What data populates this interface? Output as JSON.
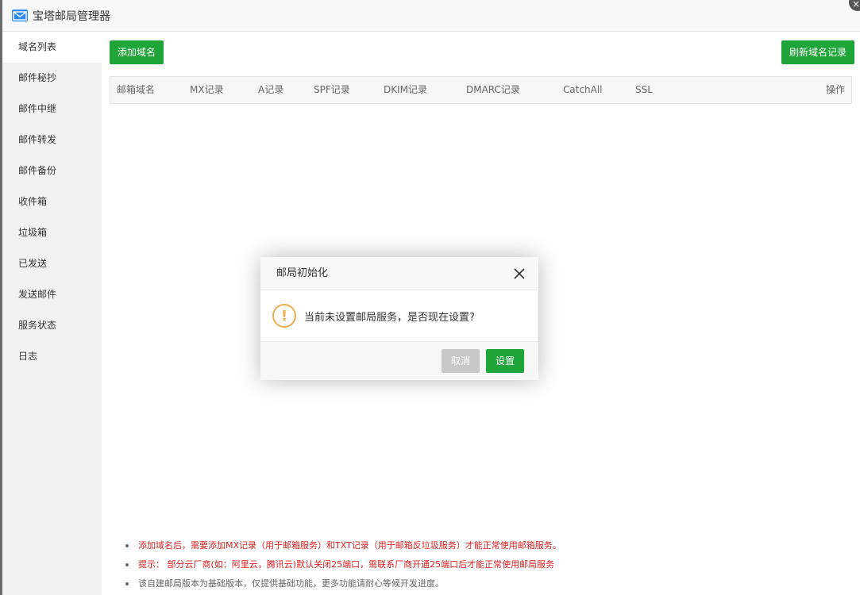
{
  "window": {
    "title": "宝塔邮局管理器"
  },
  "sidebar": {
    "items": [
      {
        "label": "域名列表"
      },
      {
        "label": "邮件秘抄"
      },
      {
        "label": "邮件中继"
      },
      {
        "label": "邮件转发"
      },
      {
        "label": "邮件备份"
      },
      {
        "label": "收件箱"
      },
      {
        "label": "垃圾箱"
      },
      {
        "label": "已发送"
      },
      {
        "label": "发送邮件"
      },
      {
        "label": "服务状态"
      },
      {
        "label": "日志"
      }
    ]
  },
  "toolbar": {
    "add_label": "添加域名",
    "refresh_label": "刷新域名记录"
  },
  "table": {
    "columns": [
      "邮箱域名",
      "MX记录",
      "A记录",
      "SPF记录",
      "DKIM记录",
      "DMARC记录",
      "CatchAll",
      "SSL",
      "操作"
    ]
  },
  "notes": [
    "添加域名后，需要添加MX记录（用于邮箱服务）和TXT记录（用于邮箱反垃圾服务）才能正常使用邮箱服务。",
    "提示： 部分云厂商(如：阿里云，腾讯云)默认关闭25端口，需联系厂商开通25端口后才能正常使用邮局服务",
    "该自建邮局版本为基础版本，仅提供基础功能，更多功能请耐心等候开发进度。"
  ],
  "modal": {
    "title": "邮局初始化",
    "icon_glyph": "!",
    "message": "当前未设置邮局服务，是否现在设置?",
    "cancel_label": "取消",
    "confirm_label": "设置"
  },
  "corner_close_glyph": "×",
  "colors": {
    "accent_green": "#20a53a",
    "warning_orange": "#f0ad4e",
    "note_red": "#e02020"
  }
}
